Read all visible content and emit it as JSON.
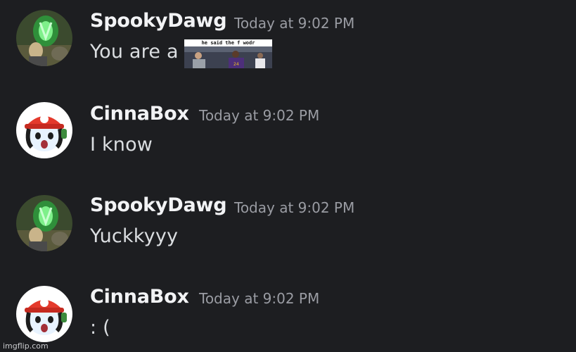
{
  "messages": [
    {
      "username": "SpookyDawg",
      "timestamp": "Today at 9:02 PM",
      "text": "You are a",
      "avatar": "spooky-avatar-green-glow"
    },
    {
      "username": "CinnaBox",
      "timestamp": "Today at 9:02 PM",
      "text": "I know",
      "avatar": "cinnabox-avatar-red-cap"
    },
    {
      "username": "SpookyDawg",
      "timestamp": "Today at 9:02 PM",
      "text": "Yuckkyyy",
      "avatar": "spooky-avatar-green-glow"
    },
    {
      "username": "CinnaBox",
      "timestamp": "Today at 9:02 PM",
      "text": ": (",
      "avatar": "cinnabox-avatar-red-cap"
    }
  ],
  "embed": {
    "caption": "he said the f wodr"
  },
  "watermark": "imgflip.com",
  "colors": {
    "background": "#1d1e21",
    "username": "#f2f3f5",
    "timestamp": "#9a9ca3",
    "text": "#dbdee1"
  }
}
